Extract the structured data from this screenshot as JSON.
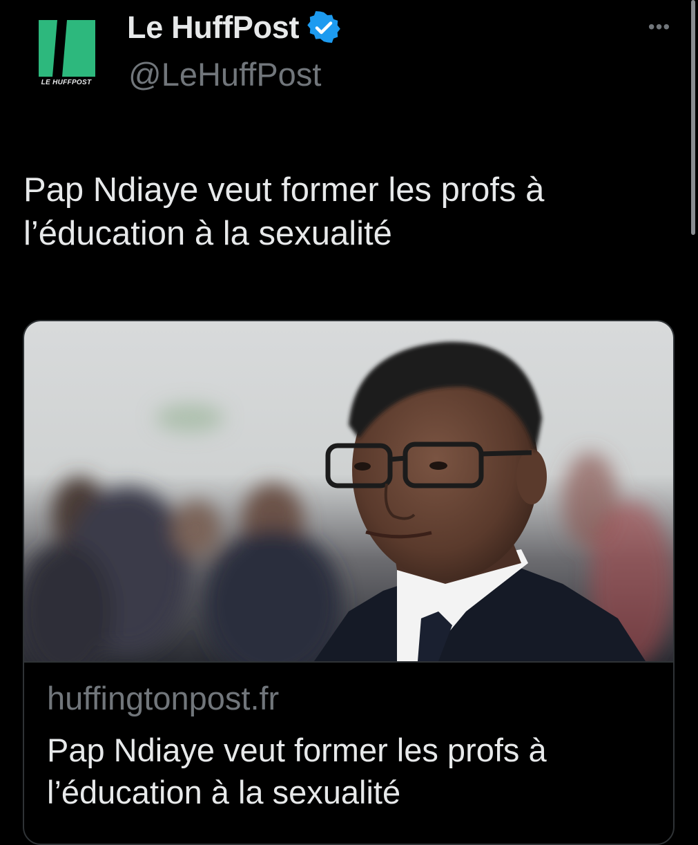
{
  "account": {
    "display_name": "Le HuffPost",
    "handle": "@LeHuffPost",
    "logo_text": "LE HUFFPOST",
    "verified": true
  },
  "tweet": {
    "text": "Pap Ndiaye veut former les profs à l’éducation à la sexualité"
  },
  "card": {
    "domain": "huffingtonpost.fr",
    "title": "Pap Ndiaye veut former les profs à l’éducation à la sexualité"
  },
  "icons": {
    "more": "more-icon",
    "verified": "verified-badge-icon"
  },
  "colors": {
    "background": "#000000",
    "text_primary": "#e7e9ea",
    "text_secondary": "#71767b",
    "verified_blue": "#1d9bf0",
    "logo_green": "#2db87d",
    "card_border": "#2f3336"
  }
}
